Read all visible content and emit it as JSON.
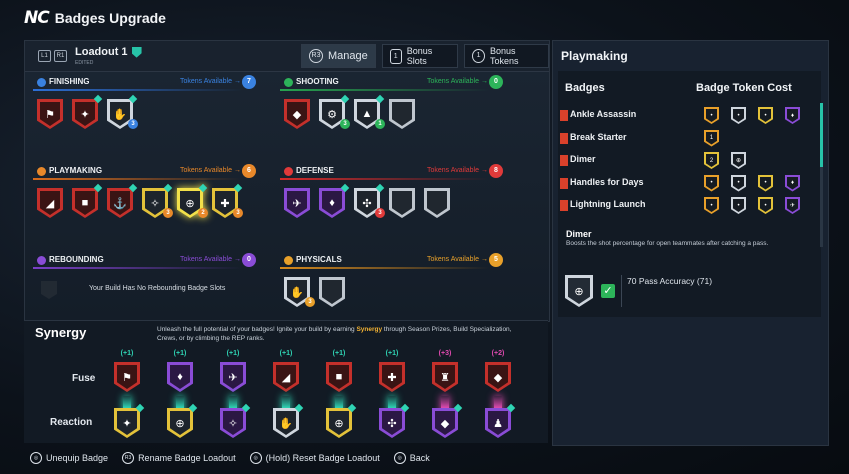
{
  "app": {
    "logo": "NC",
    "title": "Badges Upgrade"
  },
  "loadout": {
    "name": "Loadout 1",
    "sub": "EDITED",
    "btn_left": "L1",
    "btn_right": "R1"
  },
  "tabs": [
    {
      "label": "Manage",
      "icon_text": "R3"
    },
    {
      "label": "Bonus Slots",
      "icon_text": "1"
    },
    {
      "label": "Bonus Tokens",
      "icon_text": "1"
    }
  ],
  "categories": [
    {
      "name": "FINISHING",
      "avail_label": "Tokens Available",
      "tokens": "7",
      "color": "#3a82e0",
      "line": "#2d6fd6",
      "badges": [
        {
          "c": "#c4302b",
          "g": "⚑"
        },
        {
          "c": "#c4302b",
          "g": "✦"
        },
        {
          "c": "#cfd6de",
          "g": "✋",
          "dot": "#3a82e0",
          "dv": "3"
        }
      ]
    },
    {
      "name": "SHOOTING",
      "avail_label": "Tokens Available",
      "tokens": "0",
      "color": "#2db45a",
      "line": "#27a44f",
      "badges": [
        {
          "c": "#c4302b",
          "g": "◆"
        },
        {
          "c": "#cfd6de",
          "g": "⚙",
          "dot": "#2db45a",
          "dv": "3"
        },
        {
          "c": "#cfd6de",
          "g": "▲",
          "dot": "#2db45a",
          "dv": "1"
        },
        {
          "c": "#bfc6ce",
          "g": "",
          "empty": true
        }
      ]
    },
    {
      "name": "PLAYMAKING",
      "avail_label": "Tokens Available",
      "tokens": "6",
      "color": "#e8882a",
      "line": "#d86b1c",
      "badges": [
        {
          "c": "#c4302b",
          "g": "◢"
        },
        {
          "c": "#c4302b",
          "g": "■"
        },
        {
          "c": "#c4302b",
          "g": "⚓"
        },
        {
          "c": "#e3c23a",
          "g": "✧",
          "dot": "#e8882a",
          "dv": "3"
        },
        {
          "c": "#f2e04a",
          "g": "⊕",
          "dot": "#e8882a",
          "dv": "2",
          "glow": true
        },
        {
          "c": "#e3c23a",
          "g": "✚",
          "dot": "#e8882a",
          "dv": "3"
        }
      ]
    },
    {
      "name": "DEFENSE",
      "avail_label": "Tokens Available",
      "tokens": "8",
      "color": "#e03a3a",
      "line": "#d42a2a",
      "badges": [
        {
          "c": "#8a4cd6",
          "g": "✈"
        },
        {
          "c": "#8a4cd6",
          "g": "♦"
        },
        {
          "c": "#cfd6de",
          "g": "✣",
          "dot": "#e03a3a",
          "dv": "3"
        },
        {
          "c": "#bfc6ce",
          "g": "",
          "empty": true
        },
        {
          "c": "#bfc6ce",
          "g": "",
          "empty": true
        }
      ]
    },
    {
      "name": "REBOUNDING",
      "avail_label": "Tokens Available",
      "tokens": "0",
      "color": "#8a4cd6",
      "line": "#7a3fc6",
      "none": "Your Build Has No Rebounding Badge Slots"
    },
    {
      "name": "PHYSICALS",
      "avail_label": "Tokens Available",
      "tokens": "5",
      "color": "#e8a02a",
      "line": "#d88a1c",
      "badges": [
        {
          "c": "#cfd6de",
          "g": "✋",
          "dot": "#e8a02a",
          "dv": "3"
        },
        {
          "c": "#bfc6ce",
          "g": "",
          "empty": true
        }
      ]
    }
  ],
  "synergy": {
    "title": "Synergy",
    "desc_pre": "Unleash the full potential of your badges! Ignite your build by earning ",
    "desc_hl": "Synergy",
    "desc_post": " through Season Prizes, Build Specialization, Crews, or by climbing the REP ranks.",
    "fuse_label": "Fuse",
    "reaction_label": "Reaction",
    "columns": [
      {
        "plus": "(+1)",
        "pc": "#2fd4b4",
        "fuse": "#c4302b",
        "fg": "⚑",
        "react": "#e3c23a",
        "rg": "✦",
        "beam": "#2fd4b4"
      },
      {
        "plus": "(+1)",
        "pc": "#2fd4b4",
        "fuse": "#8a4cd6",
        "fg": "♦",
        "react": "#e3c23a",
        "rg": "⊕",
        "beam": "#2fd4b4"
      },
      {
        "plus": "(+1)",
        "pc": "#2fd4b4",
        "fuse": "#8a4cd6",
        "fg": "✈",
        "react": "#8a4cd6",
        "rg": "✧",
        "beam": "#2fd4b4"
      },
      {
        "plus": "(+1)",
        "pc": "#2fd4b4",
        "fuse": "#c4302b",
        "fg": "◢",
        "react": "#cfd6de",
        "rg": "✋",
        "beam": "#2fd4b4"
      },
      {
        "plus": "(+1)",
        "pc": "#2fd4b4",
        "fuse": "#c4302b",
        "fg": "■",
        "react": "#e3c23a",
        "rg": "⊕",
        "beam": "#2fd4b4"
      },
      {
        "plus": "(+1)",
        "pc": "#2fd4b4",
        "fuse": "#c4302b",
        "fg": "✚",
        "react": "#8a4cd6",
        "rg": "✣",
        "beam": "#2fd4b4"
      },
      {
        "plus": "(+3)",
        "pc": "#e04ab0",
        "fuse": "#c4302b",
        "fg": "♜",
        "react": "#8a4cd6",
        "rg": "◆",
        "beam": "#e04ab0"
      },
      {
        "plus": "(+2)",
        "pc": "#e04ab0",
        "fuse": "#c4302b",
        "fg": "◆",
        "react": "#8a4cd6",
        "rg": "♟",
        "beam": "#e04ab0"
      }
    ]
  },
  "right": {
    "title": "Playmaking",
    "col_badges": "Badges",
    "col_cost": "Badge Token Cost",
    "rows": [
      {
        "name": "Ankle Assassin",
        "tokens": [
          {
            "c": "#e8a02a",
            "t": "•"
          },
          {
            "c": "#cfd6de",
            "t": "•"
          },
          {
            "c": "#e3c23a",
            "t": "•"
          },
          {
            "c": "#8a4cd6",
            "t": "♦"
          }
        ]
      },
      {
        "name": "Break Starter",
        "tokens": [
          {
            "c": "#e8a02a",
            "t": "1"
          }
        ]
      },
      {
        "name": "Dimer",
        "tokens": [
          {
            "c": "#e3c23a",
            "t": "2"
          },
          {
            "c": "#cfd6de",
            "t": "⊕"
          }
        ]
      },
      {
        "name": "Handles for Days",
        "tokens": [
          {
            "c": "#e8a02a",
            "t": "•"
          },
          {
            "c": "#cfd6de",
            "t": "•"
          },
          {
            "c": "#e3c23a",
            "t": "•"
          },
          {
            "c": "#8a4cd6",
            "t": "♦"
          }
        ]
      },
      {
        "name": "Lightning Launch",
        "tokens": [
          {
            "c": "#e8a02a",
            "t": "•"
          },
          {
            "c": "#cfd6de",
            "t": "•"
          },
          {
            "c": "#e3c23a",
            "t": "•"
          },
          {
            "c": "#8a4cd6",
            "t": "✈"
          }
        ]
      }
    ],
    "detail": {
      "name": "Dimer",
      "desc": "Boosts the shot percentage for open teammates after catching a pass.",
      "effect": "70 Pass Accuracy (71)"
    }
  },
  "footer": [
    {
      "label": "Unequip Badge",
      "key": "◎"
    },
    {
      "label": "Rename Badge Loadout",
      "key": "R3"
    },
    {
      "label": "(Hold) Reset Badge Loadout",
      "key": "◎"
    },
    {
      "label": "Back",
      "key": "◎"
    }
  ]
}
